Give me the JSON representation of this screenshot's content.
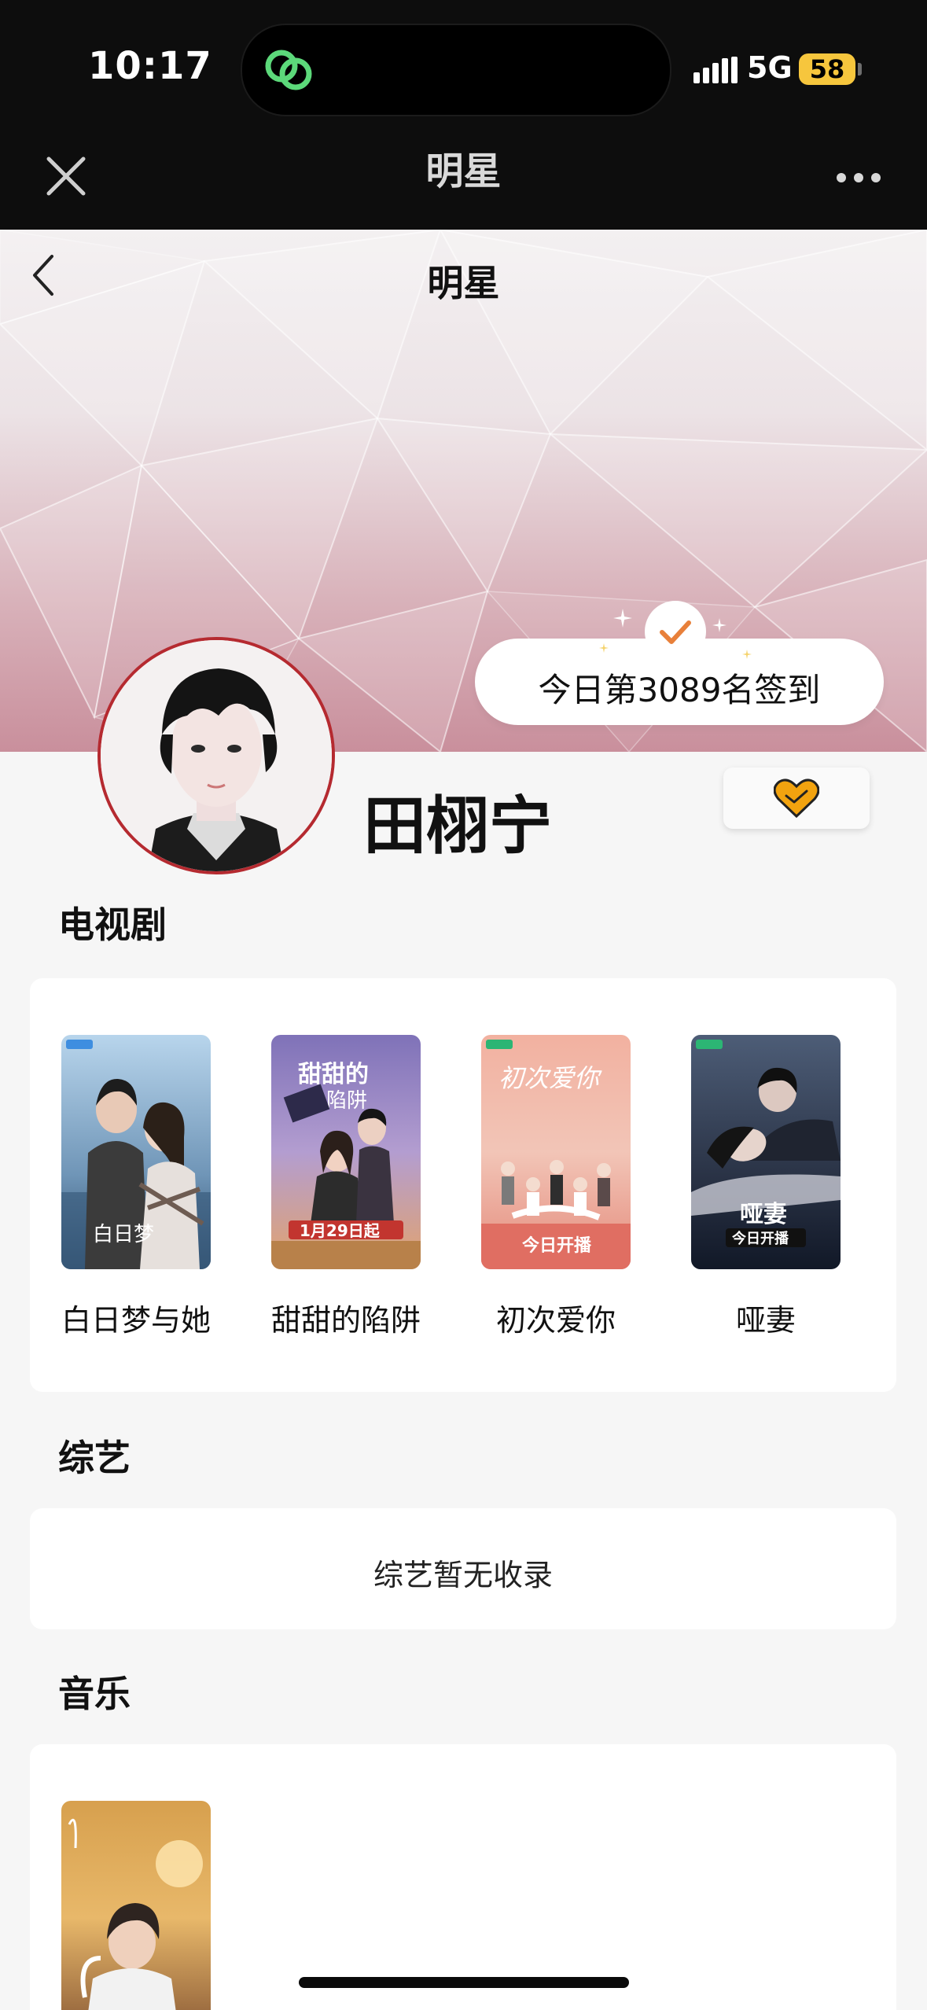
{
  "status_bar": {
    "time": "10:17",
    "network": "5G",
    "battery": "58"
  },
  "webview": {
    "title": "明星"
  },
  "header": {
    "title": "明星"
  },
  "checkin": {
    "text": "今日第3089名签到"
  },
  "profile": {
    "name": "田栩宁"
  },
  "sections": {
    "tv": {
      "title": "电视剧",
      "items": [
        {
          "title": "白日梦与她"
        },
        {
          "title": "甜甜的陷阱"
        },
        {
          "title": "初次爱你"
        },
        {
          "title": "哑妻"
        }
      ]
    },
    "variety": {
      "title": "综艺",
      "empty": "综艺暂无收录"
    },
    "music": {
      "title": "音乐"
    }
  },
  "colors": {
    "avatar_border": "#b52a30",
    "follow_heart": "#f2a30f",
    "checkin_mark": "#e8803a",
    "battery": "#f6c63d"
  }
}
